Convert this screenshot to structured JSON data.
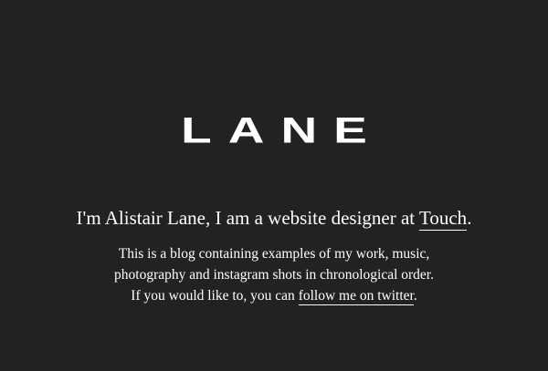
{
  "header": {
    "logo_text": "LANE"
  },
  "intro": {
    "text_before_link": "I'm Alistair Lane, I am a website designer at ",
    "link_text": "Touch",
    "text_after_link": "."
  },
  "description": {
    "line1": "This is a blog containing examples of my work, music,",
    "line2": "photography and instagram shots in chronological order.",
    "line3_before_link": "If you would like to, you can ",
    "line3_link_text": "follow me on twitter",
    "line3_after_link": "."
  },
  "colors": {
    "background": "#222222",
    "text": "#ffffff"
  }
}
